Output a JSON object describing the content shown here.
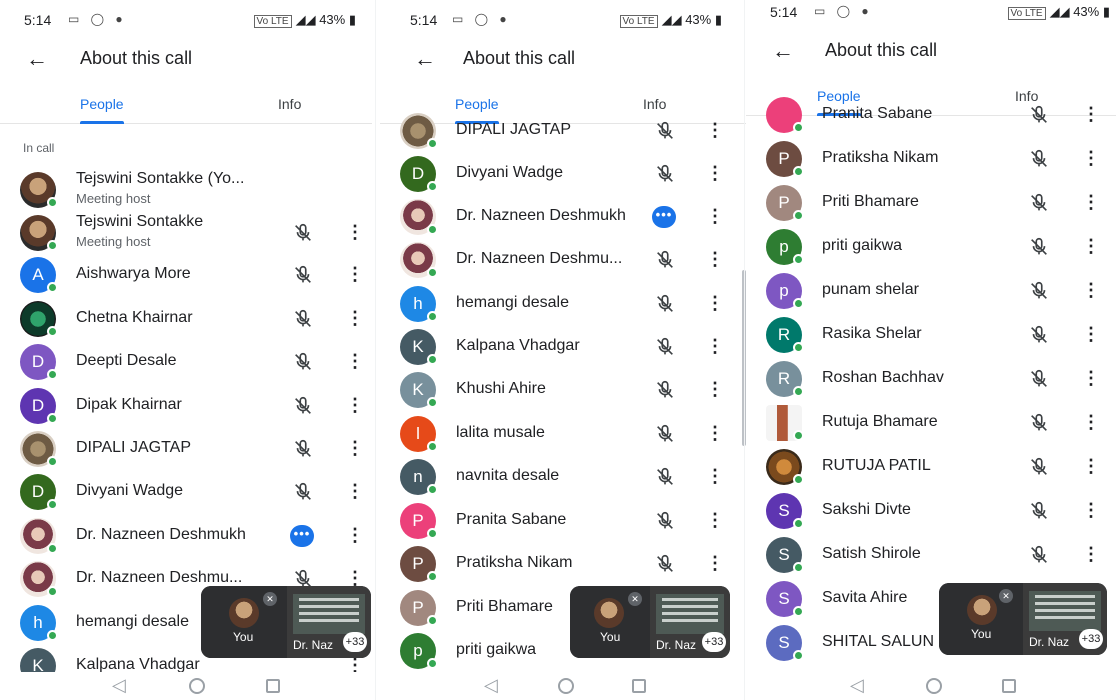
{
  "colors": {
    "accent": "#1a73e8",
    "online": "#34a853"
  },
  "panels": [
    {
      "status": {
        "time": "5:14",
        "icons": "▭ ◯ ●",
        "battery": "43%",
        "net": "Vo LTE"
      },
      "title": "About this call",
      "tabs": [
        "People",
        "Info"
      ],
      "section": "In call",
      "rows": [
        {
          "name": "Tejswini Sontakke (Yo...",
          "sub": "Meeting host",
          "avatar": "photo",
          "letter": "",
          "mute": false,
          "more": false
        },
        {
          "name": "Tejswini Sontakke",
          "sub": "Meeting host",
          "avatar": "photo",
          "letter": "",
          "mute": true,
          "more": true
        },
        {
          "name": "Aishwarya More",
          "avatar": "#1a73e8",
          "letter": "A",
          "mute": true,
          "more": true
        },
        {
          "name": "Chetna Khairnar",
          "avatar": "photo3",
          "letter": "",
          "mute": true,
          "more": true
        },
        {
          "name": "Deepti Desale",
          "avatar": "#7e57c2",
          "letter": "D",
          "mute": true,
          "more": true
        },
        {
          "name": "Dipak Khairnar",
          "avatar": "#5e35b1",
          "letter": "D",
          "mute": true,
          "more": true
        },
        {
          "name": "DIPALI JAGTAP",
          "avatar": "photo4",
          "letter": "",
          "mute": true,
          "more": true
        },
        {
          "name": "Divyani Wadge",
          "avatar": "#33691e",
          "letter": "D",
          "mute": true,
          "more": true
        },
        {
          "name": "Dr. Nazneen Deshmukh",
          "avatar": "photo2",
          "letter": "",
          "mute": false,
          "speaking": true,
          "more": true
        },
        {
          "name": "Dr. Nazneen Deshmu...",
          "avatar": "photo2",
          "letter": "",
          "mute": true,
          "more": true
        },
        {
          "name": "hemangi desale",
          "avatar": "#1e88e5",
          "letter": "h",
          "mute": true,
          "more": true
        },
        {
          "name": "Kalpana Vhadgar",
          "avatar": "#455a64",
          "letter": "K",
          "mute": false,
          "more": true
        }
      ],
      "pip": {
        "you": "You",
        "share": "Dr. Naz",
        "count": "+33"
      }
    },
    {
      "status": {
        "time": "5:14",
        "icons": "▭ ◯ ●",
        "battery": "43%",
        "net": "Vo LTE"
      },
      "title": "About this call",
      "tabs": [
        "People",
        "Info"
      ],
      "rows": [
        {
          "name": "DIPALI JAGTAP",
          "avatar": "photo4",
          "letter": "",
          "mute": true,
          "more": true
        },
        {
          "name": "Divyani Wadge",
          "avatar": "#33691e",
          "letter": "D",
          "mute": true,
          "more": true
        },
        {
          "name": "Dr. Nazneen Deshmukh",
          "avatar": "photo2",
          "letter": "",
          "mute": false,
          "speaking": true,
          "more": true
        },
        {
          "name": "Dr. Nazneen Deshmu...",
          "avatar": "photo2",
          "letter": "",
          "mute": true,
          "more": true
        },
        {
          "name": "hemangi desale",
          "avatar": "#1e88e5",
          "letter": "h",
          "mute": true,
          "more": true
        },
        {
          "name": "Kalpana Vhadgar",
          "avatar": "#455a64",
          "letter": "K",
          "mute": true,
          "more": true
        },
        {
          "name": "Khushi Ahire",
          "avatar": "#78909c",
          "letter": "K",
          "mute": true,
          "more": true
        },
        {
          "name": "lalita musale",
          "avatar": "#e64a19",
          "letter": "l",
          "mute": true,
          "more": true
        },
        {
          "name": "navnita desale",
          "avatar": "#455a64",
          "letter": "n",
          "mute": true,
          "more": true
        },
        {
          "name": "Pranita Sabane",
          "avatar": "#ec407a",
          "letter": "P",
          "mute": true,
          "more": true
        },
        {
          "name": "Pratiksha Nikam",
          "avatar": "#6d4c41",
          "letter": "P",
          "mute": true,
          "more": true
        },
        {
          "name": "Priti Bhamare",
          "avatar": "#a1887f",
          "letter": "P",
          "mute": true,
          "more": true
        },
        {
          "name": "priti gaikwa",
          "avatar": "#2e7d32",
          "letter": "p",
          "mute": false,
          "more": false
        }
      ],
      "pip": {
        "you": "You",
        "share": "Dr. Naz",
        "count": "+33"
      }
    },
    {
      "status": {
        "time": "5:14",
        "icons": "▭ ◯ ●",
        "battery": "43%",
        "net": "Vo LTE"
      },
      "title": "About this call",
      "tabs": [
        "People",
        "Info"
      ],
      "rows": [
        {
          "name": "Pranita Sabane",
          "avatar": "#ec407a",
          "letter": "",
          "mute": true,
          "more": true
        },
        {
          "name": "Pratiksha Nikam",
          "avatar": "#6d4c41",
          "letter": "P",
          "mute": true,
          "more": true
        },
        {
          "name": "Priti Bhamare",
          "avatar": "#a1887f",
          "letter": "P",
          "mute": true,
          "more": true
        },
        {
          "name": "priti gaikwa",
          "avatar": "#2e7d32",
          "letter": "p",
          "mute": true,
          "more": true
        },
        {
          "name": "punam shelar",
          "avatar": "#7e57c2",
          "letter": "p",
          "mute": true,
          "more": true
        },
        {
          "name": "Rasika Shelar",
          "avatar": "#00796b",
          "letter": "R",
          "mute": true,
          "more": true
        },
        {
          "name": "Roshan Bachhav",
          "avatar": "#78909c",
          "letter": "R",
          "mute": true,
          "more": true
        },
        {
          "name": "Rutuja Bhamare",
          "avatar": "photo6",
          "letter": "",
          "mute": true,
          "more": true
        },
        {
          "name": "RUTUJA PATIL",
          "avatar": "photo5",
          "letter": "",
          "mute": true,
          "more": true
        },
        {
          "name": "Sakshi Divte",
          "avatar": "#5e35b1",
          "letter": "S",
          "mute": true,
          "more": true
        },
        {
          "name": "Satish Shirole",
          "avatar": "#455a64",
          "letter": "S",
          "mute": true,
          "more": true
        },
        {
          "name": "Savita Ahire",
          "avatar": "#7e57c2",
          "letter": "S",
          "mute": false,
          "more": false
        },
        {
          "name": "SHITAL SALUN",
          "avatar": "#5c6bc0",
          "letter": "S",
          "mute": false,
          "more": false
        }
      ],
      "pip": {
        "you": "You",
        "share": "Dr. Naz",
        "count": "+33"
      }
    }
  ]
}
